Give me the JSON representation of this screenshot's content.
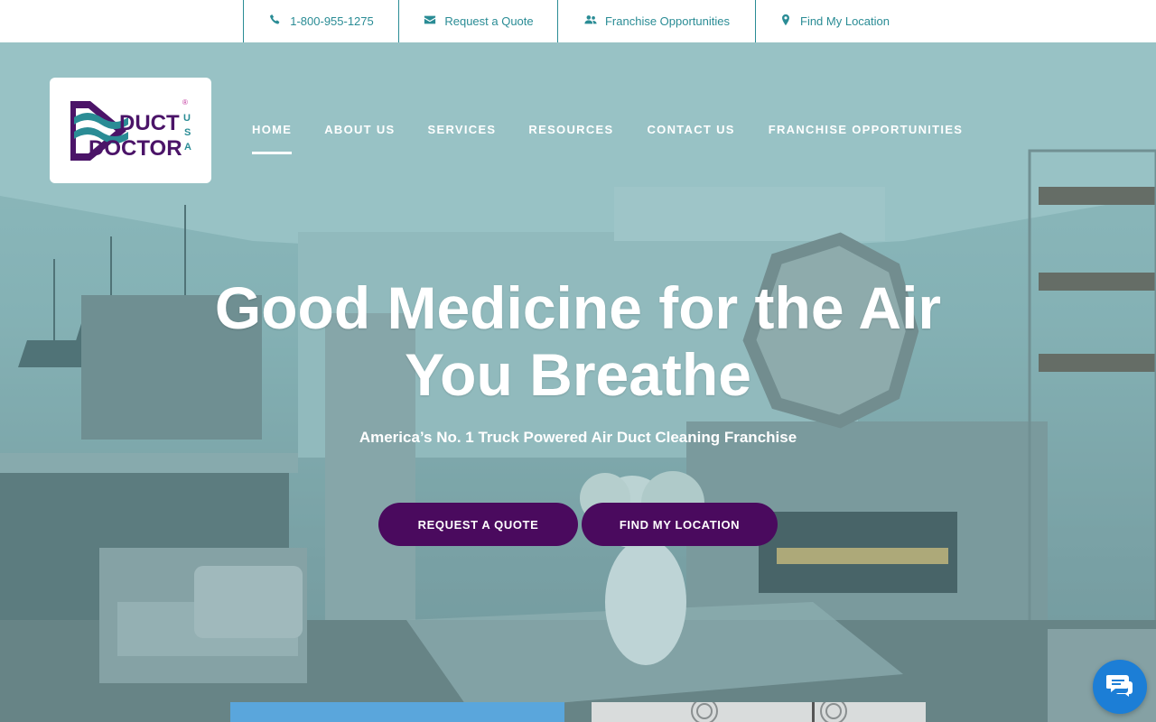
{
  "topbar": {
    "phone": "1-800-955-1275",
    "quote": "Request a Quote",
    "franchise": "Franchise Opportunities",
    "location": "Find My Location"
  },
  "logo": {
    "line1": "DUCT",
    "line2": "DOCTOR",
    "side": "USA",
    "reg": "®"
  },
  "nav": {
    "items": [
      {
        "label": "HOME",
        "active": true
      },
      {
        "label": "ABOUT US"
      },
      {
        "label": "SERVICES"
      },
      {
        "label": "RESOURCES"
      },
      {
        "label": "CONTACT US"
      },
      {
        "label": "FRANCHISE OPPORTUNITIES"
      }
    ]
  },
  "hero": {
    "headline_line1": "Good Medicine for the Air",
    "headline_line2": "You Breathe",
    "subheadline": "America’s No. 1 Truck Powered Air Duct Cleaning Franchise",
    "cta_quote": "REQUEST A QUOTE",
    "cta_location": "FIND MY LOCATION"
  },
  "colors": {
    "teal": "#2a8c95",
    "purple": "#4a0a5e",
    "chat_blue": "#1c7ed6"
  },
  "icons": [
    "phone-icon",
    "envelope-icon",
    "users-icon",
    "map-marker-icon",
    "chat-icon"
  ]
}
